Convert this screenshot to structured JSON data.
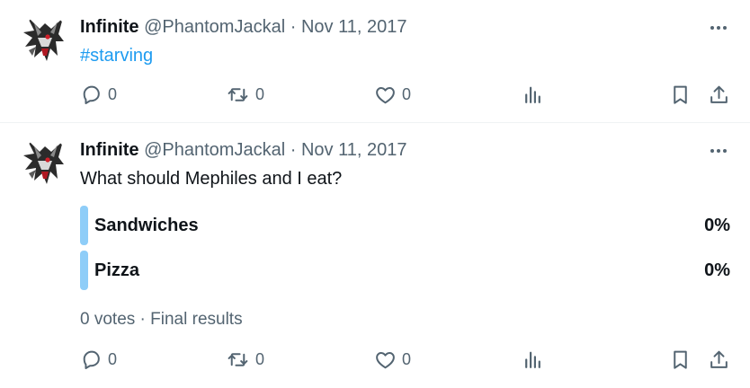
{
  "colors": {
    "text": "#0f1419",
    "secondary": "#536471",
    "link": "#1d9bf0",
    "poll_bar": "#8ecdf8",
    "divider": "#eff3f4"
  },
  "tweets": [
    {
      "name": "Infinite",
      "handle": "@PhantomJackal",
      "separator": "·",
      "date": "Nov 11, 2017",
      "text": "#starving",
      "replies": "0",
      "retweets": "0",
      "likes": "0"
    },
    {
      "name": "Infinite",
      "handle": "@PhantomJackal",
      "separator": "·",
      "date": "Nov 11, 2017",
      "text": "What should Mephiles and I eat?",
      "poll": {
        "options": [
          {
            "label": "Sandwiches",
            "percent": "0%"
          },
          {
            "label": "Pizza",
            "percent": "0%"
          }
        ],
        "votes": "0 votes",
        "status": "Final results",
        "separator": "·"
      },
      "replies": "0",
      "retweets": "0",
      "likes": "0"
    }
  ],
  "icons": {
    "reply": "reply-icon",
    "retweet": "retweet-icon",
    "like": "heart-icon",
    "views": "analytics-icon",
    "bookmark": "bookmark-icon",
    "share": "share-icon",
    "more": "more-icon"
  }
}
